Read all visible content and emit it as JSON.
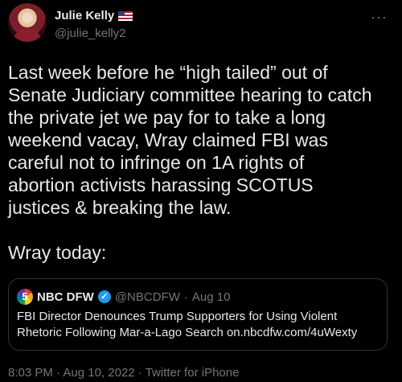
{
  "author": {
    "name": "Julie Kelly",
    "flag_icon": "us-flag-icon",
    "handle": "@julie_kelly2"
  },
  "tweet": {
    "text": "Last week before he “high tailed” out of\nSenate Judiciary committee hearing to catch\nthe private jet we pay for to take a long\nweekend vacay, Wray claimed FBI was\ncareful not to infringe on 1A rights of\nabortion activists harassing SCOTUS\njustices & breaking the law.\n\nWray today:"
  },
  "quoted": {
    "name": "NBC DFW",
    "verified_icon": "verified-badge-icon",
    "handle": "@NBCDFW",
    "separator": "·",
    "date": "Aug 10",
    "text": "FBI Director Denounces Trump Supporters for Using Violent Rhetoric Following Mar-a-Lago Search on.nbcdfw.com/4uWexty"
  },
  "meta": {
    "time": "8:03 PM",
    "date": "Aug 10, 2022",
    "source": "Twitter for iPhone",
    "separator": "·"
  }
}
